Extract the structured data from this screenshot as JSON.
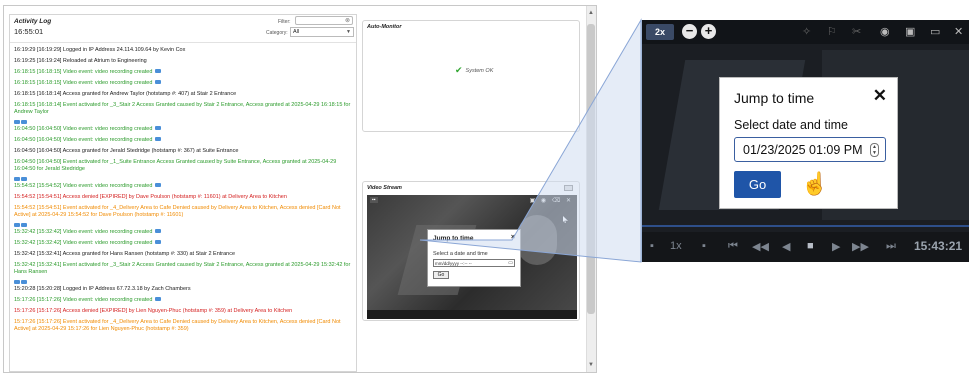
{
  "activity_log": {
    "title": "Activity Log",
    "clock": "16:55:01",
    "filter_label": "Filter:",
    "filter_value": "",
    "filter_clear_icon": "⊗",
    "category_label": "Category:",
    "category_value": "All",
    "entries": [
      {
        "color": "black",
        "text": "16:19:29 [16:19:29] Logged in IP Address 24.114.109.64 by Kevin Cox",
        "cam": false,
        "icons_before": false
      },
      {
        "color": "black",
        "text": "16:19:25 [16:19:24] Reloaded at Atrium to Engineering",
        "cam": false,
        "icons_before": false
      },
      {
        "color": "green",
        "text": "16:18:15 [16:18:15] Video event: video recording created",
        "cam": true,
        "icons_before": false
      },
      {
        "color": "green",
        "text": "16:18:15 [16:18:15] Video event: video recording created",
        "cam": true,
        "icons_before": false
      },
      {
        "color": "black",
        "text": "16:18:15 [16:18:14] Access granted for Andrew Taylor (hotstamp #: 407) at Stair 2 Entrance",
        "cam": false,
        "icons_before": false
      },
      {
        "color": "green",
        "text": "16:18:15 [16:18:14] Event activated for _3_Stair 2 Access Granted caused by Stair 2 Entrance, Access granted at 2025-04-29 16:18:15 for Andrew Taylor",
        "cam": false,
        "icons_before": false
      },
      {
        "color": "green",
        "text": "16:04:50 [16:04:50] Video event: video recording created",
        "cam": true,
        "icons_before": true
      },
      {
        "color": "green",
        "text": "16:04:50 [16:04:50] Video event: video recording created",
        "cam": true,
        "icons_before": false
      },
      {
        "color": "black",
        "text": "16:04:50 [16:04:50] Access granted for Jerald Stedridge (hotstamp #: 367) at Suite Entrance",
        "cam": false,
        "icons_before": false
      },
      {
        "color": "green",
        "text": "16:04:50 [16:04:50] Event activated for _1_Suite Entrance Access Granted caused by Suite Entrance, Access granted at 2025-04-29 16:04:50 for Jerald Stedridge",
        "cam": false,
        "icons_before": false
      },
      {
        "color": "green",
        "text": "15:54:52 [15:54:52] Video event: video recording created",
        "cam": true,
        "icons_before": true
      },
      {
        "color": "red",
        "text": "15:54:52 [15:54:51] Access denied [EXPIRED] by Dave Poulson (hotstamp #: 11601) at Delivery Area to Kitchen",
        "cam": false,
        "icons_before": false
      },
      {
        "color": "orange",
        "text": "15:54:52 [15:54:51] Event activated for _4_Delivery Area to Cafe Denied caused by Delivery Area to Kitchen, Access denied [Card Not Active] at 2025-04-29 15:54:52 for Dave Poulson (hotstamp #: 11601)",
        "cam": false,
        "icons_before": false
      },
      {
        "color": "green",
        "text": "15:32:42 [15:32:42] Video event: video recording created",
        "cam": true,
        "icons_before": true
      },
      {
        "color": "green",
        "text": "15:32:42 [15:32:42] Video event: video recording created",
        "cam": true,
        "icons_before": false
      },
      {
        "color": "black",
        "text": "15:32:42 [15:32:41] Access granted for Hans Ransen (hotstamp #: 330) at Stair 2 Entrance",
        "cam": false,
        "icons_before": false
      },
      {
        "color": "green",
        "text": "15:32:42 [15:32:41] Event activated for _3_Stair 2 Access Granted caused by Stair 2 Entrance, Access granted at 2025-04-29 15:32:42 for Hans Ransen",
        "cam": false,
        "icons_before": false
      },
      {
        "color": "black",
        "text": "15:20:28 [15:20:28] Logged in IP Address 67.72.3.18 by Zach Chambers",
        "cam": false,
        "icons_before": true
      },
      {
        "color": "green",
        "text": "15:17:26 [15:17:26] Video event: video recording created",
        "cam": true,
        "icons_before": false
      },
      {
        "color": "red",
        "text": "15:17:26 [15:17:26] Access denied [EXPIRED] by Lien Nguyen-Phuc (hotstamp #: 359) at Delivery Area to Kitchen",
        "cam": false,
        "icons_before": false
      },
      {
        "color": "orange",
        "text": "15:17:26 [15:17:26] Event activated for _4_Delivery Area to Cafe Denied caused by Delivery Area to Kitchen, Access denied [Card Not Active] at 2025-04-29 15:17:26 for Lien Nguyen-Phuc (hotstamp #: 359)",
        "cam": false,
        "icons_before": false
      }
    ]
  },
  "auto_monitor": {
    "title": "Auto-Monitor",
    "status": "System OK",
    "status_icon": "check-icon"
  },
  "video_stream": {
    "title": "Video Stream",
    "small_dialog": {
      "title": "Jump to time",
      "close": "×",
      "label": "Select a date and time",
      "input_placeholder": "mm/dd/yyyy --:-- --",
      "go": "Go"
    }
  },
  "zoom_view": {
    "zoom_label": "2x",
    "zoom_out": "−",
    "zoom_in": "+",
    "dialog": {
      "title": "Jump to time",
      "close": "✕",
      "label": "Select date and time",
      "input_value": "01/23/2025 01:09 PM",
      "go": "Go"
    },
    "speed": "1x",
    "time": "15:43:21"
  },
  "colors": {
    "green": "#2a9a2a",
    "red": "#d42020",
    "orange": "#f08a00",
    "go_button": "#1f55a8",
    "zoom_connector": "#8aa6d6"
  }
}
